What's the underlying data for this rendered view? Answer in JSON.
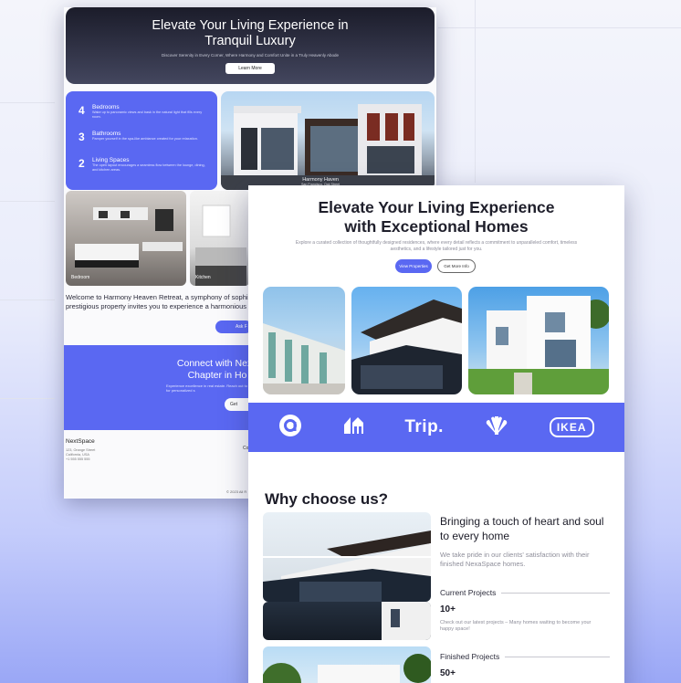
{
  "back_page": {
    "hero": {
      "title": "Elevate Your Living Experience in Tranquil Luxury",
      "subtitle": "Discover Serenity in Every Corner, Where Harmony and Comfort Unite in a Truly Heavenly Abode",
      "button": "Learn More"
    },
    "features": [
      {
        "number": "4",
        "title": "Bedrooms",
        "desc": "Wake up to panoramic views and bask in the natural light that fills every room."
      },
      {
        "number": "3",
        "title": "Bathrooms",
        "desc": "Pamper yourself in the spa-like ambiance created for your relaxation."
      },
      {
        "number": "2",
        "title": "Living Spaces",
        "desc": "The open layout encourages a seamless flow between the lounge, dining, and kitchen areas."
      }
    ],
    "property": {
      "name": "Harmony Haven",
      "location": "San Francisco, Oak Street"
    },
    "rooms": [
      "Bedroom",
      "Kitchen"
    ],
    "welcome": "Welcome to Harmony Heaven Retreat, a symphony of sophisti",
    "welcome2": "prestigious property invites you to experience a harmonious bl",
    "welcome_button": "Ask F",
    "connect": {
      "title": "Connect with Nexa Chapter in Ho",
      "desc": "Experience excellence in real estate. Reach out to us for personalized s",
      "button": "Get"
    },
    "footer": {
      "brand": "NextSpace",
      "address": [
        "123, Orange Street",
        "California, USA",
        "+1 555 555 555"
      ],
      "col_heading": "Co",
      "copyright": "© 2023 All R"
    }
  },
  "front_page": {
    "hero": {
      "title": "Elevate Your Living Experience with Exceptional Homes",
      "subtitle": "Explore a curated collection of thoughtfully designed residences, where every detail reflects a commitment to unparalleled comfort, timeless aesthetics, and a lifestyle tailored just for you.",
      "primary_button": "View Properties",
      "secondary_button": "Get More Info"
    },
    "logos": [
      "airbnb-logo",
      "hashnode-logo",
      "Trip.",
      "nbc-logo",
      "IKEA"
    ],
    "why": {
      "heading": "Why choose us?",
      "subheading": "Bringing a touch of heart and soul to every home",
      "text": "We take pride in our clients' satisfaction with their finished NexaSpace homes.",
      "stats": [
        {
          "label": "Current Projects",
          "value": "10+",
          "desc": "Check out our latest projects – Many homes waiting to become your happy space!"
        },
        {
          "label": "Finished Projects",
          "value": "50+",
          "desc": ""
        }
      ]
    }
  },
  "colors": {
    "accent": "#5a68f2",
    "dark_hero": "#1b1c2a"
  }
}
